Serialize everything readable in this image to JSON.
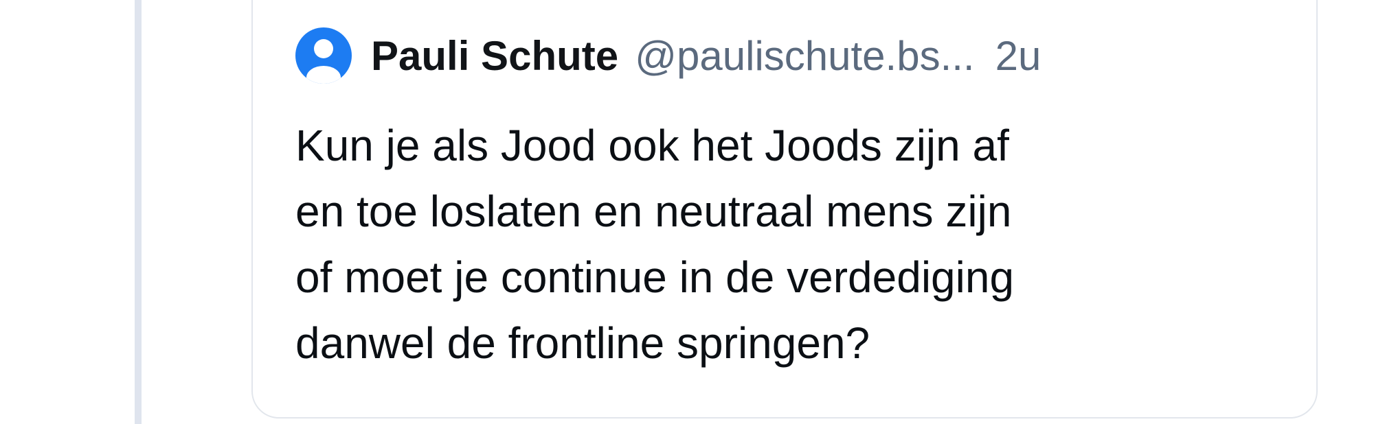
{
  "quoted_post": {
    "author": {
      "display_name": "Pauli Schute",
      "handle": "@paulischute.bs...",
      "avatar_icon": "default-user-avatar-icon"
    },
    "time_ago": "2u",
    "text_lines": [
      "Kun je als Jood ook het Joods zijn af",
      "en toe loslaten en neutraal mens zijn",
      "of moet je continue in de verdediging",
      "danwel de frontline springen?"
    ]
  },
  "colors": {
    "avatar_blue": "#1d7cf2",
    "thread_line": "#dfe4ee",
    "card_border": "#e2e6ec",
    "muted_text": "#5b6a7e",
    "main_text": "#0b0f14"
  }
}
